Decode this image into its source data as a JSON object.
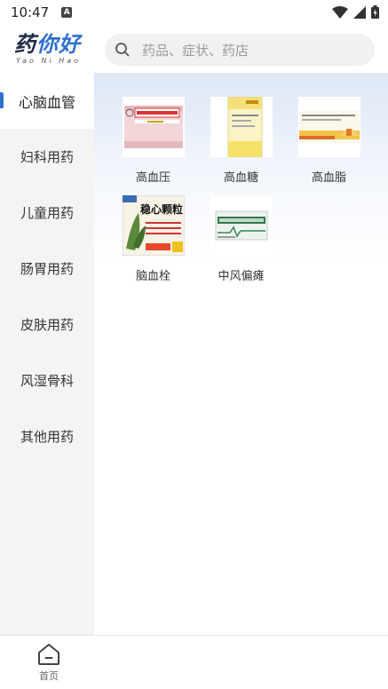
{
  "status": {
    "time": "10:47",
    "notification_letter": "A"
  },
  "header": {
    "logo_text_1": "药",
    "logo_text_2": "你好",
    "logo_sub": "Yao Ni Hao",
    "search_placeholder": "药品、症状、药店"
  },
  "sidebar": {
    "items": [
      {
        "label": "心脑血管",
        "active": true
      },
      {
        "label": "妇科用药"
      },
      {
        "label": "儿童用药"
      },
      {
        "label": "肠胃用药"
      },
      {
        "label": "皮肤用药"
      },
      {
        "label": "风湿骨科"
      },
      {
        "label": "其他用药"
      }
    ]
  },
  "content": {
    "items": [
      {
        "label": "高血压",
        "image": "hypertension-medicine-box"
      },
      {
        "label": "高血糖",
        "image": "hyperglycemia-medicine-box"
      },
      {
        "label": "高血脂",
        "image": "hyperlipidemia-medicine-box"
      },
      {
        "label": "脑血栓",
        "image": "thrombosis-medicine-box"
      },
      {
        "label": "中风偏瘫",
        "image": "stroke-medicine-box"
      }
    ],
    "thrombosis_box_text": "稳心颗粒"
  },
  "tabbar": {
    "home_label": "首页"
  },
  "colors": {
    "accent": "#2f6fd0",
    "sidebar_bg": "#f4f4f4"
  }
}
